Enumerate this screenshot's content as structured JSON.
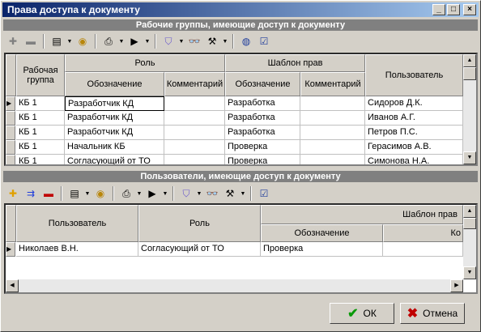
{
  "window": {
    "title": "Права доступа к документу",
    "min": "_",
    "max": "□",
    "close": "×"
  },
  "section1": {
    "title": "Рабочие группы, имеющие доступ к документу",
    "headers": {
      "group": "Рабочая группа",
      "role": "Роль",
      "role_code": "Обозначение",
      "role_comment": "Комментарий",
      "template": "Шаблон прав",
      "tpl_code": "Обозначение",
      "tpl_comment": "Комментарий",
      "user": "Пользователь"
    },
    "rows": [
      {
        "group": "КБ 1",
        "role": "Разработчик КД",
        "comment": "",
        "tpl": "Разработка",
        "tcomment": "",
        "user": "Сидоров Д.К."
      },
      {
        "group": "КБ 1",
        "role": "Разработчик КД",
        "comment": "",
        "tpl": "Разработка",
        "tcomment": "",
        "user": "Иванов А.Г."
      },
      {
        "group": "КБ 1",
        "role": "Разработчик КД",
        "comment": "",
        "tpl": "Разработка",
        "tcomment": "",
        "user": "Петров П.С."
      },
      {
        "group": "КБ 1",
        "role": "Начальник КБ",
        "comment": "",
        "tpl": "Проверка",
        "tcomment": "",
        "user": "Герасимов А.В."
      },
      {
        "group": "КБ 1",
        "role": "Согласующий от ТО",
        "comment": "",
        "tpl": "Проверка",
        "tcomment": "",
        "user": "Симонова Н.А."
      }
    ]
  },
  "section2": {
    "title": "Пользователи, имеющие доступ к документу",
    "headers": {
      "user": "Пользователь",
      "role": "Роль",
      "template": "Шаблон прав",
      "tpl_code": "Обозначение",
      "tpl_comment": "Ко"
    },
    "rows": [
      {
        "user": "Николаев В.Н.",
        "role": "Согласующий от ТО",
        "tpl": "Проверка"
      }
    ]
  },
  "buttons": {
    "ok": "ОК",
    "cancel": "Отмена"
  }
}
